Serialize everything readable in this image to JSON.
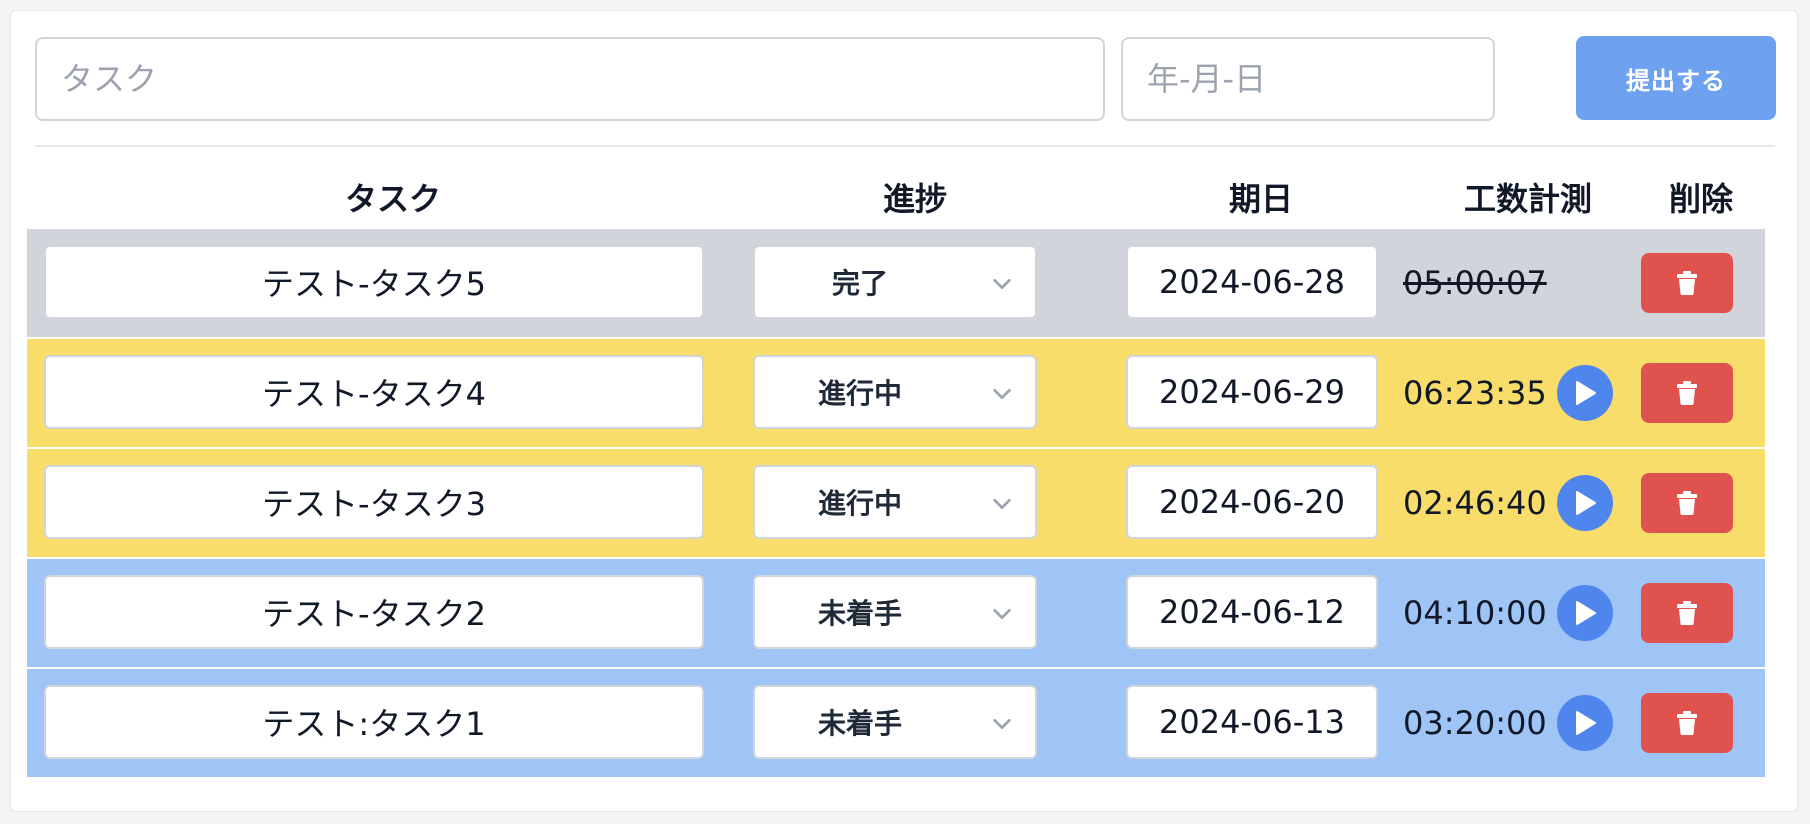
{
  "form": {
    "task_placeholder": "タスク",
    "date_placeholder": "年-月-日",
    "submit_label": "提出する"
  },
  "table": {
    "headers": {
      "task": "タスク",
      "progress": "進捗",
      "due": "期日",
      "time": "工数計測",
      "delete": "削除"
    },
    "rows": [
      {
        "task": "テスト-タスク5",
        "status": "完了",
        "due": "2024-06-28",
        "time": "05:00:07",
        "row_color": "#d1d5db",
        "completed": true
      },
      {
        "task": "テスト-タスク4",
        "status": "進行中",
        "due": "2024-06-29",
        "time": "06:23:35",
        "row_color": "#f8dd6a",
        "completed": false
      },
      {
        "task": "テスト-タスク3",
        "status": "進行中",
        "due": "2024-06-20",
        "time": "02:46:40",
        "row_color": "#f8dd6a",
        "completed": false
      },
      {
        "task": "テスト-タスク2",
        "status": "未着手",
        "due": "2024-06-12",
        "time": "04:10:00",
        "row_color": "#9fc4f6",
        "completed": false
      },
      {
        "task": "テスト:タスク1",
        "status": "未着手",
        "due": "2024-06-13",
        "time": "03:20:00",
        "row_color": "#9fc4f6",
        "completed": false
      }
    ]
  },
  "icons": {
    "play": "play-icon",
    "delete": "trash-icon",
    "chevron": "chevron-down-icon"
  },
  "colors": {
    "submit": "#6ea2f0",
    "play": "#4f86ee",
    "delete": "#e0524d"
  }
}
